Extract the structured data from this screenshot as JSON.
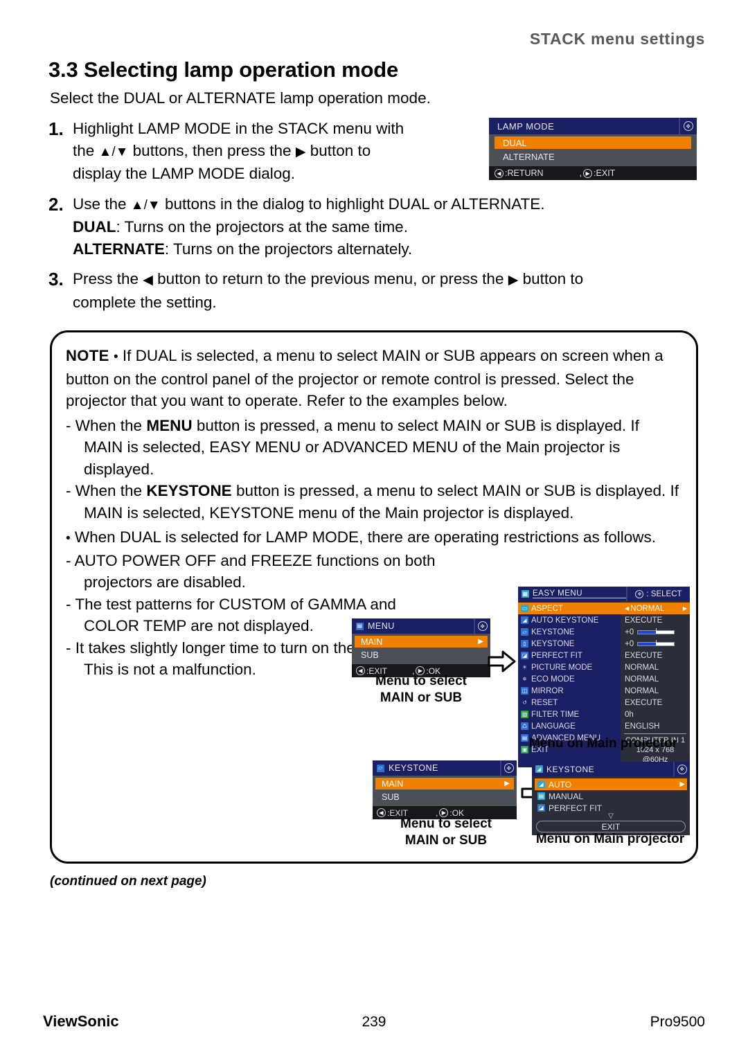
{
  "header": {
    "running_head": "STACK menu settings"
  },
  "section": {
    "title": "3.3 Selecting lamp operation mode",
    "subtitle": "Select the DUAL or ALTERNATE lamp operation mode."
  },
  "steps": [
    {
      "num": "1.",
      "line1": "Highlight LAMP MODE in the STACK menu with",
      "line2_a": "the ",
      "line2_arrows": "▲/▼",
      "line2_b": " buttons, then press the ",
      "line2_arrow2": "▶",
      "line2_c": " button to",
      "line3": "display the LAMP MODE dialog."
    },
    {
      "num": "2.",
      "line1_a": "Use the ",
      "line1_arrows": "▲/▼",
      "line1_b": " buttons in the dialog to highlight DUAL or ALTERNATE.",
      "line2_bold": "DUAL",
      "line2_rest": ": Turns on the projectors at the same time.",
      "line3_bold": "ALTERNATE",
      "line3_rest": ": Turns on the projectors alternately."
    },
    {
      "num": "3.",
      "line1_a": "Press the ",
      "line1_arrow_left": "◀",
      "line1_b": " button to return to the previous menu, or press the ",
      "line1_arrow_right": "▶",
      "line1_c": " button to",
      "line2": "complete the setting."
    }
  ],
  "note": {
    "label": "NOTE",
    "bullet": "•",
    "p1": "If DUAL is selected, a menu to select MAIN or SUB appears on screen when a button on the control panel of the projector or remote control is pressed.  Select the projector that you want to operate.  Refer to the examples below.",
    "items": [
      {
        "dash": "-",
        "pre": "When the ",
        "bold": "MENU",
        "post": " button is pressed, a menu to select MAIN or SUB is displayed.  If MAIN is selected, EASY MENU or ADVANCED MENU of the Main projector is displayed."
      },
      {
        "dash": "-",
        "pre": "When the ",
        "bold": "KEYSTONE",
        "post": " button is pressed, a menu to select MAIN or SUB is displayed.  If MAIN is selected, KEYSTONE menu of the Main projector is displayed."
      }
    ],
    "p2_bullet": "•",
    "p2": "When DUAL is selected for LAMP MODE, there are operating restrictions as follows.",
    "restrictions": [
      {
        "dash": "-",
        "text": "AUTO POWER OFF and FREEZE functions on both projectors are disabled."
      },
      {
        "dash": "-",
        "text": "The test patterns for CUSTOM of GAMMA and COLOR TEMP are not displayed."
      },
      {
        "dash": "-",
        "text": "It takes slightly longer time to turn on the projectors. This is not a malfunction."
      }
    ]
  },
  "osd": {
    "lamp_mode": {
      "title": "LAMP MODE",
      "cursor_icon": "cursor-pad-icon",
      "rows": [
        {
          "label": "DUAL",
          "selected": true
        },
        {
          "label": "ALTERNATE",
          "selected": false
        }
      ],
      "foot_left_key": "◀",
      "foot_left": ":RETURN",
      "foot_sep": ",",
      "foot_right_key": "▶",
      "foot_right": ":EXIT"
    },
    "menu_select": {
      "title": "MENU",
      "title_icon": "menu-icon",
      "cursor_icon": "cursor-pad-icon",
      "rows": [
        {
          "label": "MAIN",
          "selected": true,
          "tail": "▶"
        },
        {
          "label": "SUB",
          "selected": false,
          "tail": ""
        }
      ],
      "foot_left_key": "◀",
      "foot_left": ":EXIT",
      "foot_sep": ",",
      "foot_right_key": "▶",
      "foot_right": ":OK"
    },
    "keystone_select": {
      "title": "KEYSTONE",
      "title_icon": "keystone-icon",
      "cursor_icon": "cursor-pad-icon",
      "rows": [
        {
          "label": "MAIN",
          "selected": true,
          "tail": "▶"
        },
        {
          "label": "SUB",
          "selected": false,
          "tail": ""
        }
      ],
      "foot_left_key": "◀",
      "foot_left": ":EXIT",
      "foot_sep": ",",
      "foot_right_key": "▶",
      "foot_right": ":OK"
    },
    "easy_menu": {
      "title": "EASY MENU",
      "title_icon": "easy-menu-icon",
      "select_label": ": SELECT",
      "select_icon": "cursor-pad-icon",
      "items": [
        {
          "label": "ASPECT",
          "icon": "aspect-icon",
          "value": "NORMAL",
          "selected": true,
          "type": "arrows"
        },
        {
          "label": "AUTO KEYSTONE",
          "icon": "auto-keystone-icon",
          "value": "EXECUTE",
          "selected": false,
          "type": "text"
        },
        {
          "label": "KEYSTONE",
          "icon": "keystone-v-icon",
          "value": "+0",
          "selected": false,
          "type": "slider"
        },
        {
          "label": "KEYSTONE",
          "icon": "keystone-h-icon",
          "value": "+0",
          "selected": false,
          "type": "slider"
        },
        {
          "label": "PERFECT FIT",
          "icon": "perfect-fit-icon",
          "value": "EXECUTE",
          "selected": false,
          "type": "text"
        },
        {
          "label": "PICTURE MODE",
          "icon": "picture-mode-icon",
          "value": "NORMAL",
          "selected": false,
          "type": "text"
        },
        {
          "label": "ECO MODE",
          "icon": "eco-mode-icon",
          "value": "NORMAL",
          "selected": false,
          "type": "text"
        },
        {
          "label": "MIRROR",
          "icon": "mirror-icon",
          "value": "NORMAL",
          "selected": false,
          "type": "text"
        },
        {
          "label": "RESET",
          "icon": "reset-icon",
          "value": "EXECUTE",
          "selected": false,
          "type": "text"
        },
        {
          "label": "FILTER TIME",
          "icon": "filter-time-icon",
          "value": "0h",
          "selected": false,
          "type": "text"
        },
        {
          "label": "LANGUAGE",
          "icon": "language-icon",
          "value": "ENGLISH",
          "selected": false,
          "type": "text"
        },
        {
          "label": "ADVANCED MENU",
          "icon": "advanced-menu-icon",
          "value": "",
          "selected": false,
          "type": "none"
        },
        {
          "label": "EXIT",
          "icon": "exit-icon",
          "value": "",
          "selected": false,
          "type": "none"
        }
      ],
      "info_line1": "COMPUTER IN 1",
      "info_line2": "1024 x 768 @60Hz",
      "arrow_left": "◀",
      "arrow_right": "▶"
    },
    "keystone_main": {
      "title": "KEYSTONE",
      "title_icon": "keystone-icon",
      "cursor_icon": "cursor-pad-icon",
      "items": [
        {
          "label": "AUTO",
          "icon": "auto-keystone-icon",
          "selected": true,
          "tail": "▶"
        },
        {
          "label": "MANUAL",
          "icon": "manual-icon",
          "selected": false,
          "tail": ""
        },
        {
          "label": "PERFECT FIT",
          "icon": "perfect-fit-icon",
          "selected": false,
          "tail": ""
        }
      ],
      "caret": "▽",
      "exit_label": "EXIT"
    }
  },
  "captions": {
    "menu_select": "Menu to select\nMAIN or SUB",
    "easy_menu": "Menu on Main projector",
    "keystone_select": "Menu to select\nMAIN or SUB",
    "keystone_main": "Menu on Main projector"
  },
  "continued": "(continued on next page)",
  "footer": {
    "brand": "ViewSonic",
    "page": "239",
    "model": "Pro9500"
  },
  "colors": {
    "highlight_orange": "#f08000",
    "osd_title_navy": "#1b1f63",
    "osd_body_gray": "#4b4f56",
    "osd_panel_dark": "#2a2e38",
    "osd_foot_black": "#17181c",
    "slider_blue": "#1e45d8",
    "header_gray": "#58595b"
  }
}
